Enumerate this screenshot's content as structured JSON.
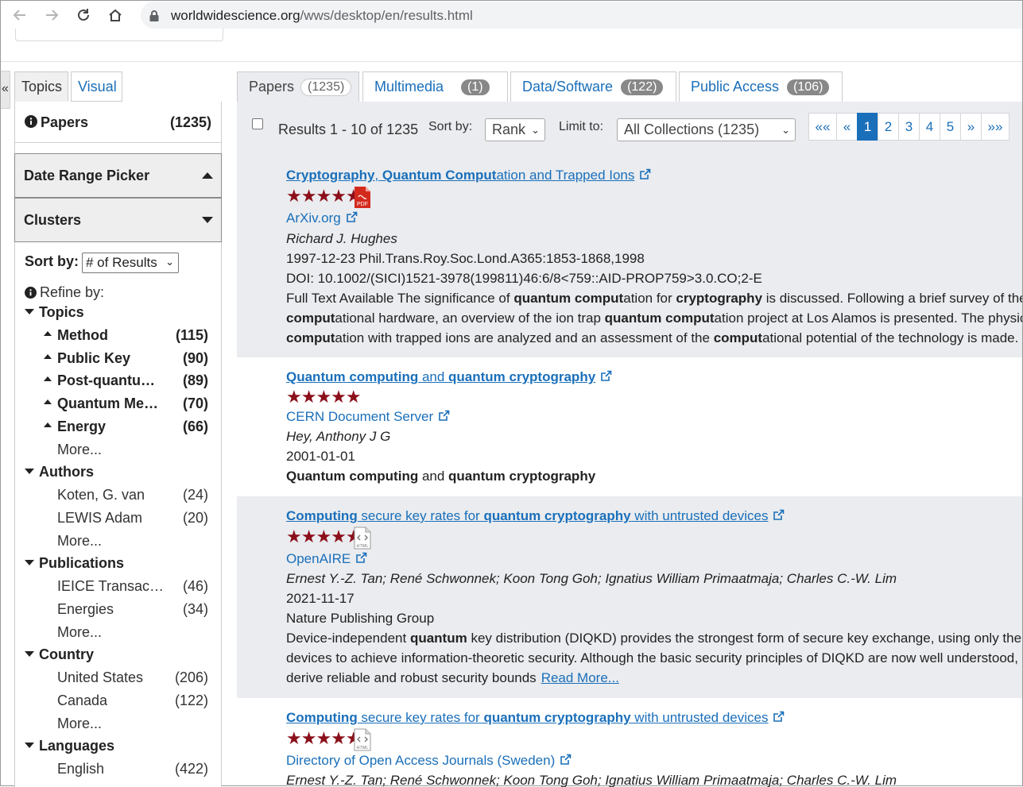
{
  "browser": {
    "url_host": "worldwidescience.org",
    "url_path": "/wws/desktop/en/results.html"
  },
  "sidebar": {
    "collapse_glyph": "«",
    "tabs": [
      {
        "label": "Topics"
      },
      {
        "label": "Visual"
      }
    ],
    "papers_label": "Papers",
    "papers_count": "(1235)",
    "date_range_label": "Date Range Picker",
    "clusters_label": "Clusters",
    "sort_label": "Sort by:",
    "sort_value": "# of Results",
    "refine_label": "Refine by:",
    "topics": {
      "label": "Topics",
      "items": [
        {
          "label": "Method",
          "count": "(115)"
        },
        {
          "label": "Public Key",
          "count": "(90)"
        },
        {
          "label": "Post-quantu…",
          "count": "(89)"
        },
        {
          "label": "Quantum Me…",
          "count": "(70)"
        },
        {
          "label": "Energy",
          "count": "(66)"
        }
      ],
      "more": "More..."
    },
    "authors": {
      "label": "Authors",
      "items": [
        {
          "label": "Koten, G. van",
          "count": "(24)"
        },
        {
          "label": "LEWIS Adam",
          "count": "(20)"
        }
      ],
      "more": "More..."
    },
    "publications": {
      "label": "Publications",
      "items": [
        {
          "label": "IEICE Transac…",
          "count": "(46)"
        },
        {
          "label": "Energies",
          "count": "(34)"
        }
      ],
      "more": "More..."
    },
    "country": {
      "label": "Country",
      "items": [
        {
          "label": "United States",
          "count": "(206)"
        },
        {
          "label": "Canada",
          "count": "(122)"
        }
      ],
      "more": "More..."
    },
    "languages": {
      "label": "Languages",
      "items": [
        {
          "label": "English",
          "count": "(422)"
        }
      ]
    }
  },
  "tabs": [
    {
      "label": "Papers",
      "count": "(1235)"
    },
    {
      "label": "Multimedia",
      "count": "(1)"
    },
    {
      "label": "Data/Software",
      "count": "(122)"
    },
    {
      "label": "Public Access",
      "count": "(106)"
    }
  ],
  "toolbar": {
    "results_text": "Results 1 - 10 of 1235",
    "sort_label": "Sort by:",
    "sort_value": "Rank",
    "limit_label": "Limit to:",
    "limit_value": "All Collections (1235)",
    "pager": [
      "««",
      "«",
      "1",
      "2",
      "3",
      "4",
      "5",
      "»",
      "»»"
    ],
    "current_page": "1"
  },
  "results": [
    {
      "title_parts": [
        {
          "t": "Cryptography",
          "b": true
        },
        {
          "t": ", ",
          "b": false
        },
        {
          "t": "Quantum Comput",
          "b": true
        },
        {
          "t": "ation and Trapped Ions",
          "b": false
        }
      ],
      "rating": "★★★★★",
      "source": "ArXiv.org",
      "authors": "Richard J. Hughes",
      "date": "1997-12-23 Phil.Trans.Roy.Soc.Lond.A365:1853-1868,1998",
      "doi": "DOI: 10.1002/(SICI)1521-3978(199811)46:6/8<759::AID-PROP759>3.0.CO;2-E",
      "abstract_lines": [
        [
          {
            "t": "Full Text Available The significance of ",
            "b": false
          },
          {
            "t": "quantum comput",
            "b": true
          },
          {
            "t": "ation for ",
            "b": false
          },
          {
            "t": "cryptography",
            "b": true
          },
          {
            "t": " is discussed. Following a brief survey of the requirements for quantum",
            "b": false
          }
        ],
        [
          {
            "t": "comput",
            "b": true
          },
          {
            "t": "ational hardware, an overview of the ion trap ",
            "b": false
          },
          {
            "t": "quantum comput",
            "b": true
          },
          {
            "t": "ation project at Los Alamos is presented. The physical obstacles to",
            "b": false
          }
        ],
        [
          {
            "t": "comput",
            "b": true
          },
          {
            "t": "ation with trapped ions are analyzed and an assessment of the ",
            "b": false
          },
          {
            "t": "comput",
            "b": true
          },
          {
            "t": "ational potential of the technology is made.",
            "b": false
          }
        ]
      ]
    },
    {
      "title_parts": [
        {
          "t": "Quantum computing",
          "b": true
        },
        {
          "t": " and ",
          "b": false
        },
        {
          "t": "quantum cryptography",
          "b": true
        }
      ],
      "rating": "★★★★★",
      "source": "CERN Document Server",
      "authors": "Hey, Anthony J G",
      "date": "2001-01-01",
      "abstract_lines": [
        [
          {
            "t": "Quantum computing",
            "b": true
          },
          {
            "t": " and ",
            "b": false
          },
          {
            "t": "quantum cryptography",
            "b": true
          }
        ]
      ]
    },
    {
      "title_parts": [
        {
          "t": "Computing",
          "b": true
        },
        {
          "t": " secure key rates for ",
          "b": false
        },
        {
          "t": "quantum cryptography",
          "b": true
        },
        {
          "t": " with untrusted devices",
          "b": false
        }
      ],
      "rating": "★★★★★",
      "source": "OpenAIRE",
      "authors": "Ernest Y.-Z. Tan; René Schwonnek; Koon Tong Goh; Ignatius William Primaatmaja; Charles C.-W. Lim",
      "date": "2021-11-17",
      "publisher": "Nature Publishing Group",
      "abstract_lines": [
        [
          {
            "t": "Device-independent ",
            "b": false
          },
          {
            "t": "quantum",
            "b": true
          },
          {
            "t": " key distribution (DIQKD) provides the strongest form of secure key exchange, using only the input-output statistics of the",
            "b": false
          }
        ],
        [
          {
            "t": "devices to achieve information-theoretic security. Although the basic security principles of DIQKD are now well understood, it remains a technical challenge to",
            "b": false
          }
        ],
        [
          {
            "t": "derive reliable and robust security bounds",
            "b": false
          }
        ]
      ],
      "read_more": "Read More..."
    },
    {
      "title_parts": [
        {
          "t": "Computing",
          "b": true
        },
        {
          "t": " secure key rates for ",
          "b": false
        },
        {
          "t": "quantum cryptography",
          "b": true
        },
        {
          "t": " with untrusted devices",
          "b": false
        }
      ],
      "rating": "★★★★★",
      "source": "Directory of Open Access Journals (Sweden)",
      "authors": "Ernest Y.-Z. Tan; René Schwonnek; Koon Tong Goh; Ignatius William Primaatmaja; Charles C.-W. Lim"
    }
  ],
  "icons": [
    "back-arrow-icon",
    "forward-arrow-icon",
    "reload-icon",
    "home-icon",
    "lock-icon",
    "info-icon",
    "external-link-icon",
    "pdf-icon",
    "html-icon"
  ],
  "colors": {
    "link": "#1a6fba",
    "star": "#8b0f1a",
    "shade": "#eaecef",
    "badge": "#888888"
  }
}
